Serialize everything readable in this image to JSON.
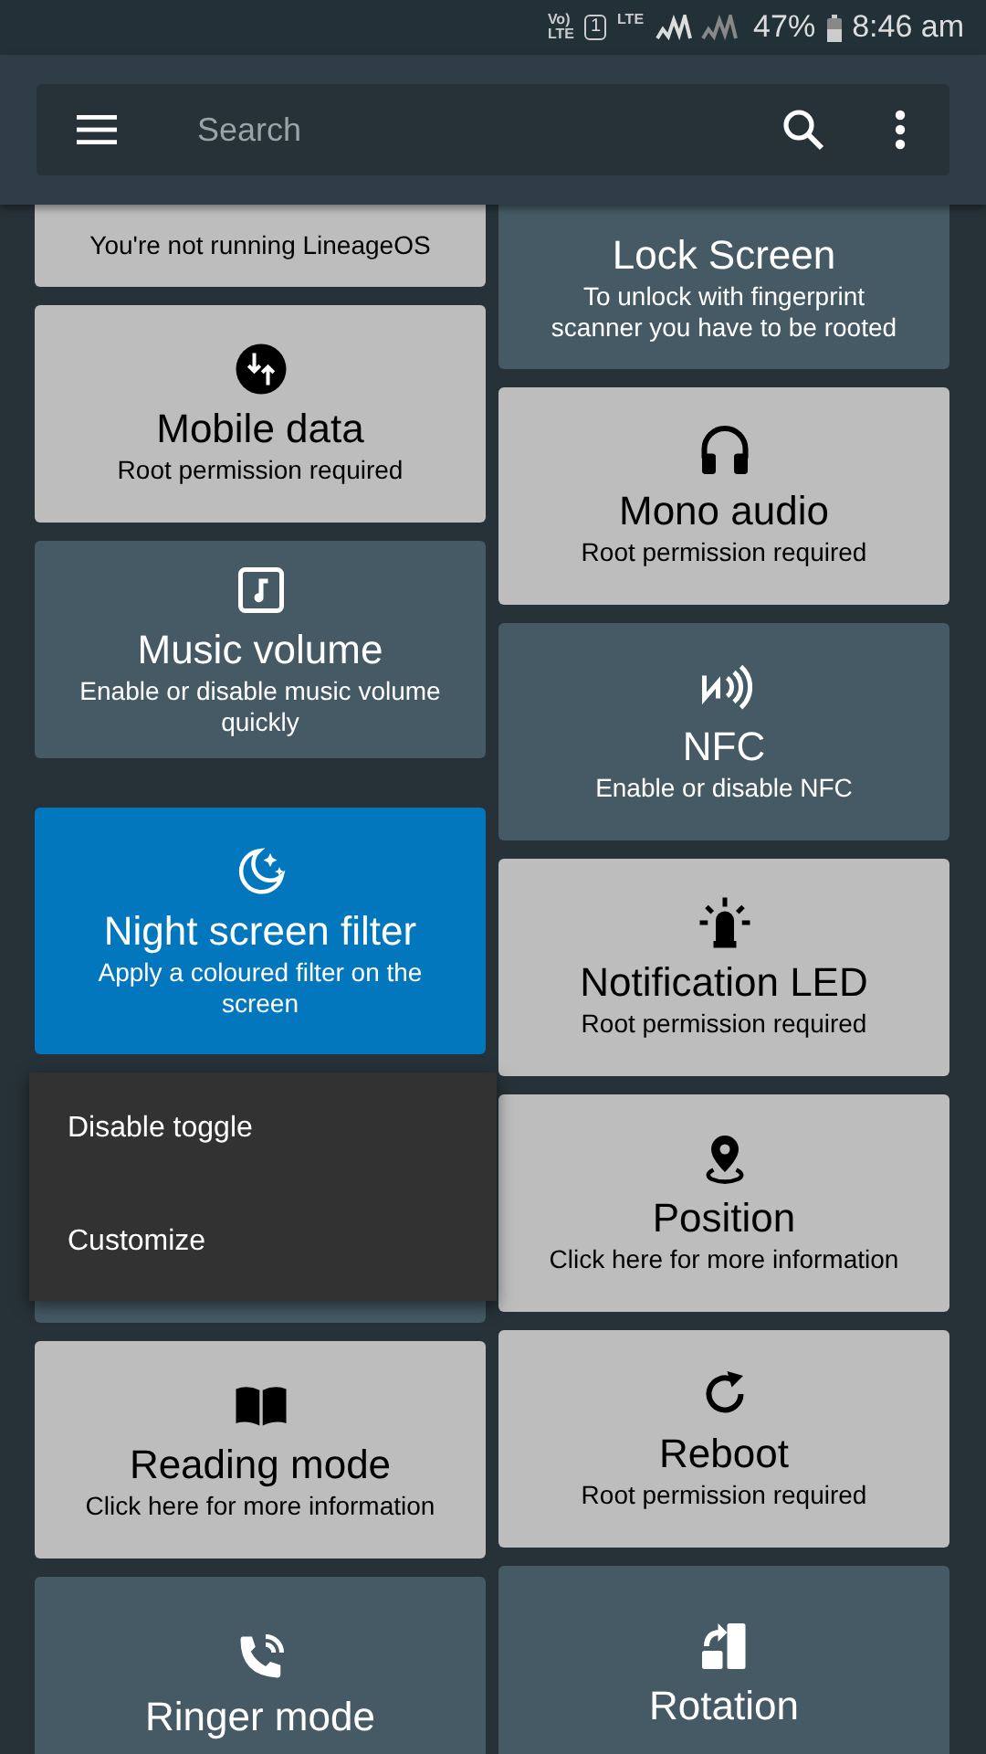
{
  "status_bar": {
    "volte": [
      "Vo)",
      "LTE"
    ],
    "sim": "1",
    "network": "LTE",
    "battery": "47%",
    "time": "8:46 am"
  },
  "search": {
    "placeholder": "Search"
  },
  "columns": [
    [
      {
        "partial": true,
        "enabled": false,
        "selected": false,
        "description": "You're not running LineageOS"
      },
      {
        "enabled": false,
        "selected": false,
        "title": "Mobile data",
        "description": "Root permission required"
      },
      {
        "enabled": true,
        "selected": false,
        "title": "Music volume",
        "description": "Enable or disable music volume quickly"
      },
      {
        "enabled": true,
        "selected": true,
        "title": "Night screen filter",
        "description": "Apply a coloured filter on the screen"
      },
      {
        "enabled": true,
        "selected": false,
        "covered": true
      },
      {
        "enabled": false,
        "selected": false,
        "title": "Reading mode",
        "description": "Click here for more information"
      },
      {
        "enabled": true,
        "selected": false,
        "title": "Ringer mode"
      }
    ],
    [
      {
        "partial": true,
        "enabled": true,
        "selected": false,
        "title": "Lock Screen",
        "description": "To unlock with fingerprint scanner you have to be rooted"
      },
      {
        "enabled": false,
        "selected": false,
        "title": "Mono audio",
        "description": "Root permission required"
      },
      {
        "enabled": true,
        "selected": false,
        "title": "NFC",
        "description": "Enable or disable NFC"
      },
      {
        "enabled": false,
        "selected": false,
        "title": "Notification LED",
        "description": "Root permission required"
      },
      {
        "enabled": false,
        "selected": false,
        "title": "Position",
        "description": "Click here for more information"
      },
      {
        "enabled": false,
        "selected": false,
        "title": "Reboot",
        "description": "Root permission required"
      },
      {
        "enabled": true,
        "selected": false,
        "title": "Rotation"
      }
    ]
  ],
  "context_menu": {
    "items": [
      "Disable toggle",
      "Customize"
    ]
  }
}
